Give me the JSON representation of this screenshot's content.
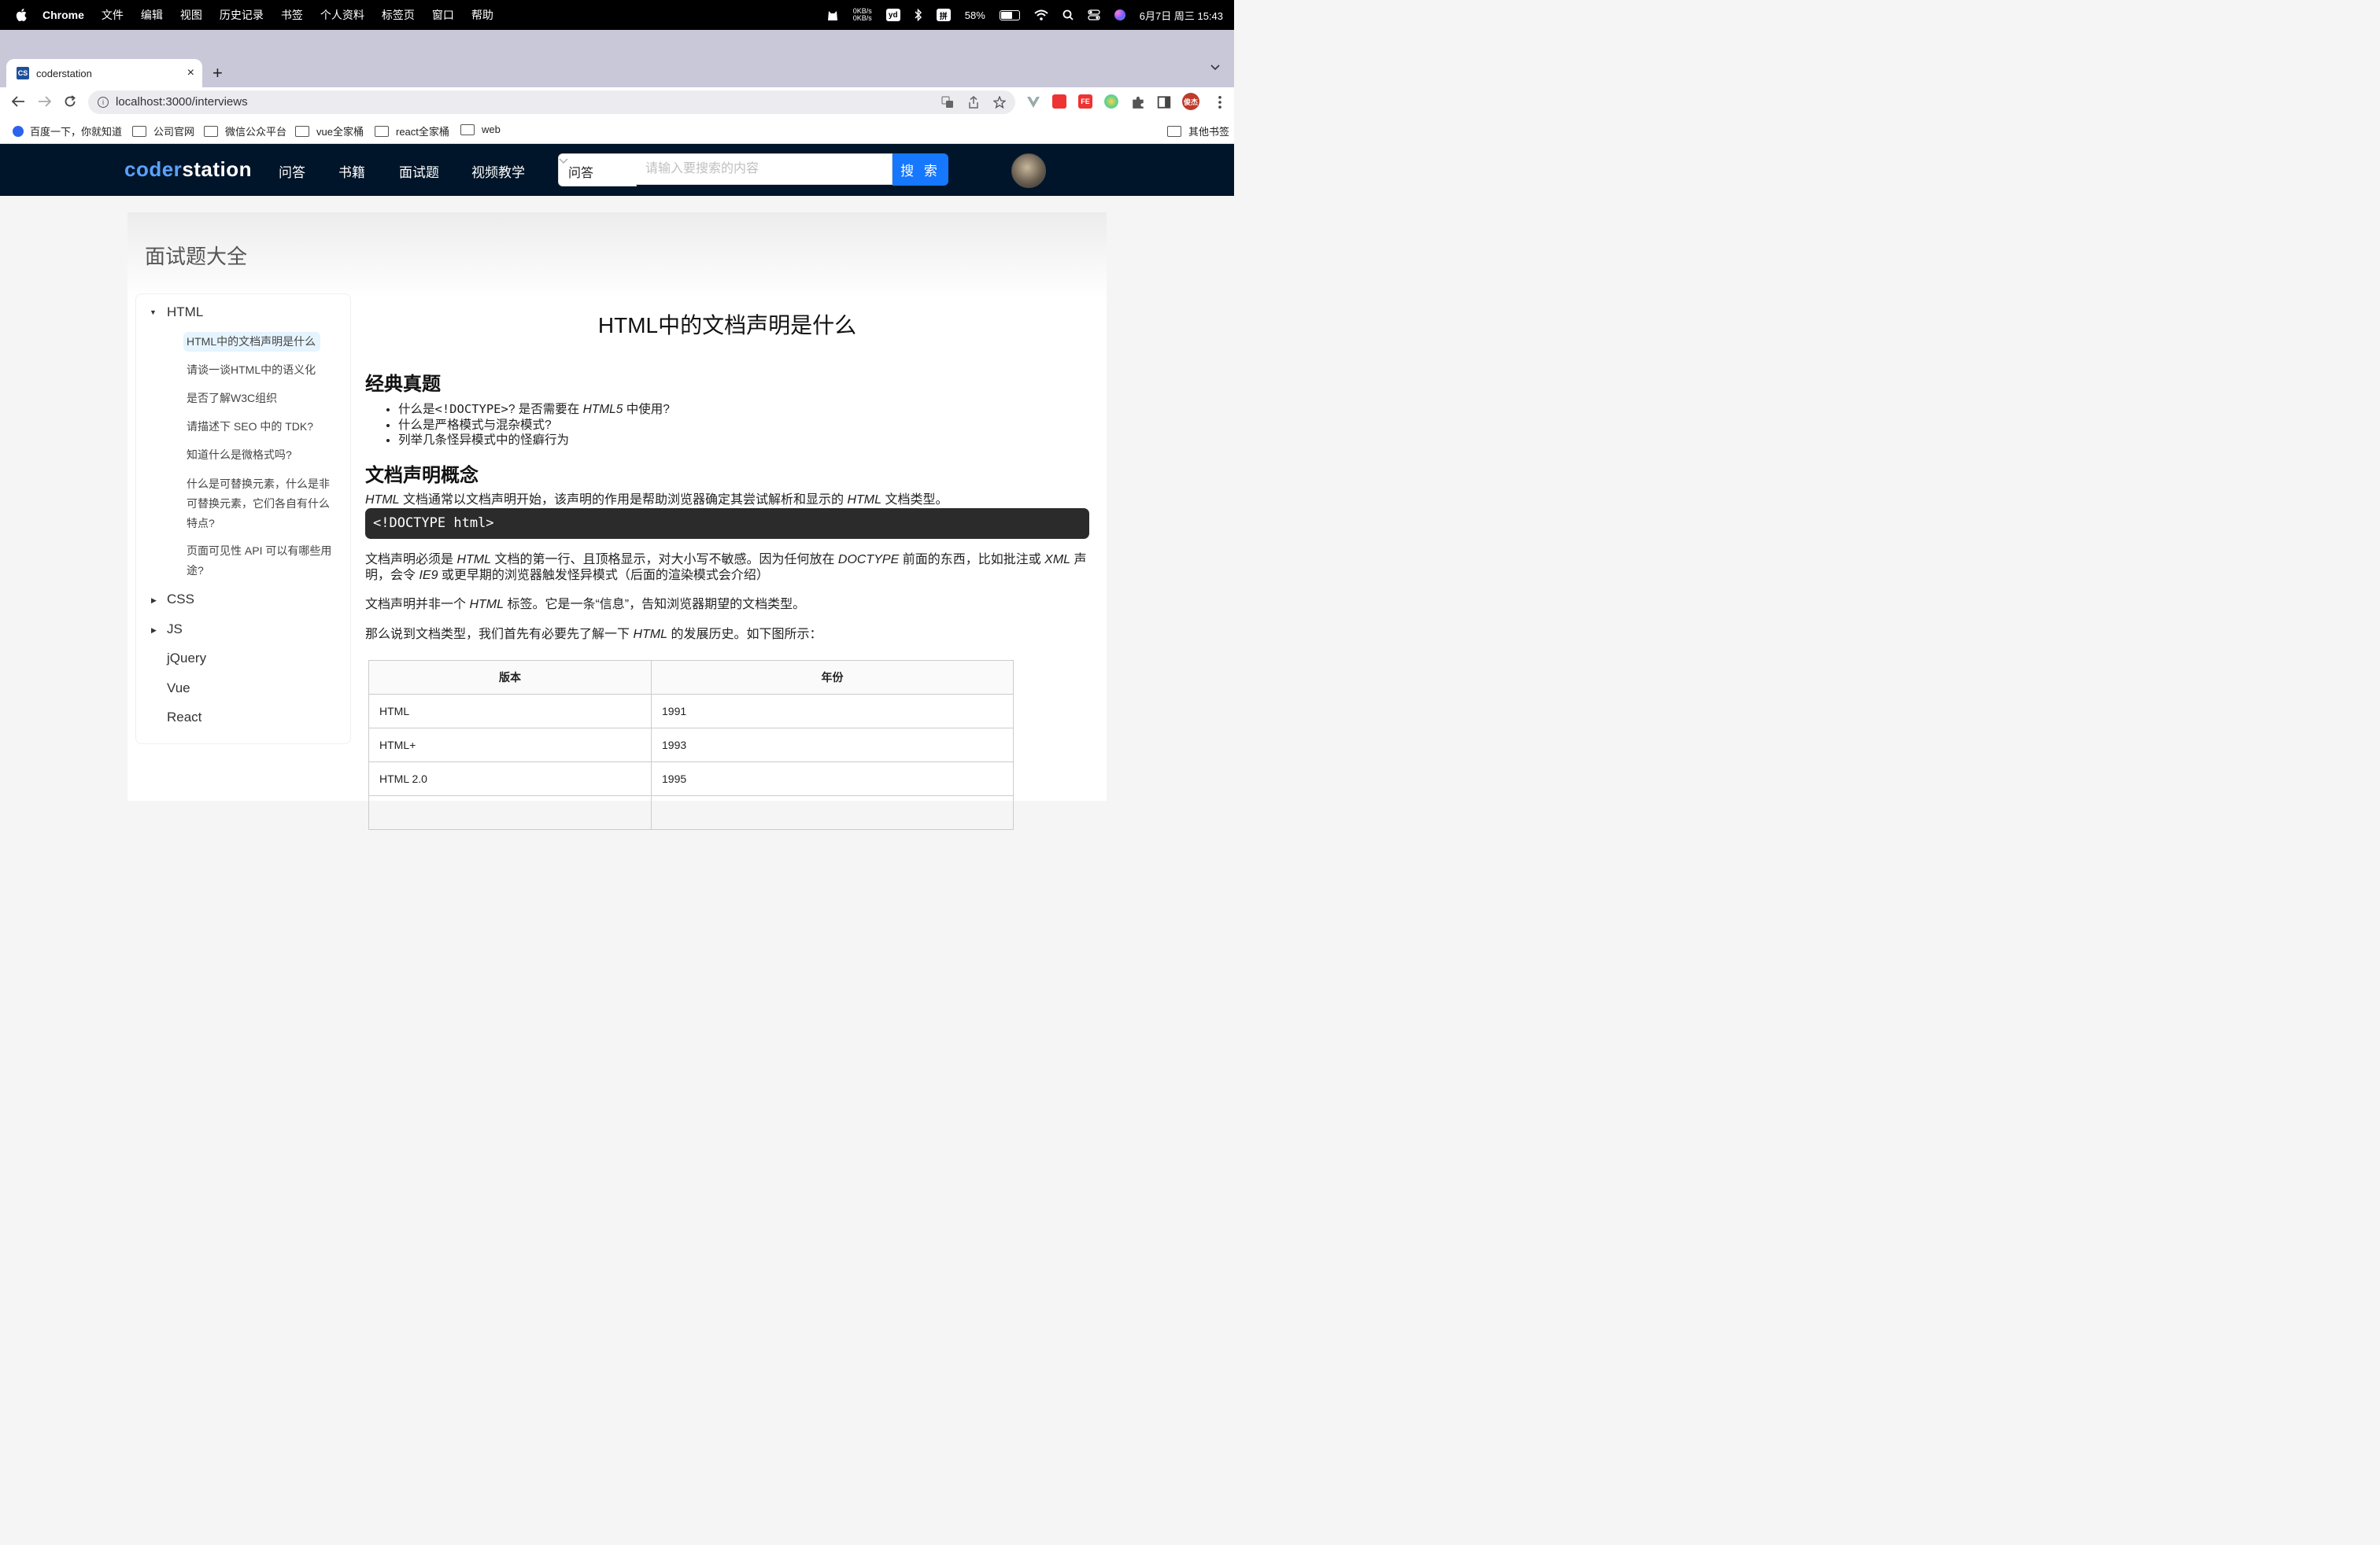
{
  "menubar": {
    "app": "Chrome",
    "items": [
      "文件",
      "编辑",
      "视图",
      "历史记录",
      "书签",
      "个人资料",
      "标签页",
      "窗口",
      "帮助"
    ],
    "net_up": "0KB/s",
    "net_down": "0KB/s",
    "yd": "yd",
    "ime": "拼",
    "battery_percent": "58%",
    "battery_level": 0.58,
    "clock": "6月7日 周三  15:43"
  },
  "tab": {
    "favicon": "CS",
    "title": "coderstation",
    "close": "×"
  },
  "newtab": "+",
  "omnibox": {
    "url": "localhost:3000/interviews"
  },
  "extensions": {
    "fe": "FE",
    "profile": "俊杰"
  },
  "bookmarks": {
    "items": [
      "百度一下，你就知道",
      "公司官网",
      "微信公众平台",
      "vue全家桶",
      "react全家桶",
      "web"
    ],
    "other": "其他书签"
  },
  "site": {
    "logo_a": "coder",
    "logo_b": "station",
    "nav": [
      "问答",
      "书籍",
      "面试题",
      "视频教学"
    ],
    "search_category": "问答",
    "search_placeholder": "请输入要搜索的内容",
    "search_button": "搜 索"
  },
  "page": {
    "title": "面试题大全",
    "tree": {
      "html": "HTML",
      "html_items": [
        "HTML中的文档声明是什么",
        "请谈一谈HTML中的语义化",
        "是否了解W3C组织",
        "请描述下 SEO 中的 TDK?",
        "知道什么是微格式吗?",
        "什么是可替换元素，什么是非可替换元素，它们各自有什么特点?",
        "页面可见性 API 可以有哪些用途?"
      ],
      "others": [
        "CSS",
        "JS",
        "jQuery",
        "Vue",
        "React"
      ]
    },
    "article": {
      "title": "HTML中的文档声明是什么",
      "h_classic": "经典真题",
      "q1_a": "什么是",
      "q1_code": "<!DOCTYPE>",
      "q1_b": "? 是否需要在 ",
      "q1_em": "HTML5",
      "q1_c": " 中使用?",
      "q2": "什么是严格模式与混杂模式?",
      "q3": "列举几条怪异模式中的怪癖行为",
      "h_concept": "文档声明概念",
      "p1_em": "HTML",
      "p1_a": " 文档通常以文档声明开始，该声明的作用是帮助浏览器确定其尝试解析和显示的 ",
      "p1_em2": "HTML",
      "p1_b": " 文档类型。",
      "code": "<!DOCTYPE html>",
      "p2_a": "文档声明必须是 ",
      "p2_em1": "HTML",
      "p2_b": " 文档的第一行、且顶格显示，对大小写不敏感。因为任何放在 ",
      "p2_em2": "DOCTYPE",
      "p2_c": " 前面的东西，比如批注或 ",
      "p2_em3": "XML",
      "p2_d": " 声明，会令 ",
      "p2_em4": "IE9",
      "p2_e": " 或更早期的浏览器触发怪异模式（后面的渲染模式会介绍）",
      "p3_a": "文档声明并非一个 ",
      "p3_em": "HTML",
      "p3_b": " 标签。它是一条“信息”，告知浏览器期望的文档类型。",
      "p4_a": "那么说到文档类型，我们首先有必要先了解一下 ",
      "p4_em": "HTML",
      "p4_b": " 的发展历史。如下图所示：",
      "table": {
        "headers": [
          "版本",
          "年份"
        ],
        "rows": [
          [
            "HTML",
            "1991"
          ],
          [
            "HTML+",
            "1993"
          ],
          [
            "HTML 2.0",
            "1995"
          ]
        ]
      }
    }
  }
}
